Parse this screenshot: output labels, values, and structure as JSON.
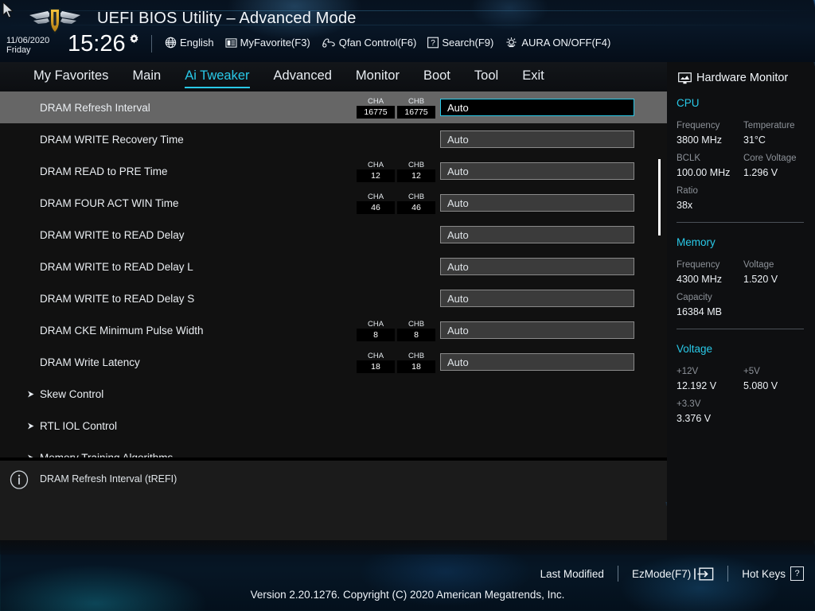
{
  "header": {
    "title": "UEFI BIOS Utility – Advanced Mode",
    "date": "11/06/2020",
    "weekday": "Friday",
    "time": "15:26",
    "gear_icon": "gear-icon",
    "items": [
      {
        "label": "English",
        "icon": "globe-icon"
      },
      {
        "label": "MyFavorite(F3)",
        "icon": "list-icon"
      },
      {
        "label": "Qfan Control(F6)",
        "icon": "fan-icon"
      },
      {
        "label": "Search(F9)",
        "icon": "question-box-icon"
      },
      {
        "label": "AURA ON/OFF(F4)",
        "icon": "aura-light-icon"
      }
    ]
  },
  "nav": {
    "tabs": [
      {
        "label": "My Favorites",
        "active": false
      },
      {
        "label": "Main",
        "active": false
      },
      {
        "label": "Ai Tweaker",
        "active": true
      },
      {
        "label": "Advanced",
        "active": false
      },
      {
        "label": "Monitor",
        "active": false
      },
      {
        "label": "Boot",
        "active": false
      },
      {
        "label": "Tool",
        "active": false
      },
      {
        "label": "Exit",
        "active": false
      }
    ],
    "active_color": "#29c9e8"
  },
  "settings": {
    "channel_labels": {
      "a": "CHA",
      "b": "CHB"
    },
    "rows": [
      {
        "label": "DRAM Refresh Interval",
        "cha": "16775",
        "chb": "16775",
        "value": "Auto",
        "selected": true,
        "submenu": false
      },
      {
        "label": "DRAM WRITE Recovery Time",
        "cha": null,
        "chb": null,
        "value": "Auto",
        "selected": false,
        "submenu": false
      },
      {
        "label": "DRAM READ to PRE Time",
        "cha": "12",
        "chb": "12",
        "value": "Auto",
        "selected": false,
        "submenu": false
      },
      {
        "label": "DRAM FOUR ACT WIN Time",
        "cha": "46",
        "chb": "46",
        "value": "Auto",
        "selected": false,
        "submenu": false
      },
      {
        "label": "DRAM WRITE to READ Delay",
        "cha": null,
        "chb": null,
        "value": "Auto",
        "selected": false,
        "submenu": false
      },
      {
        "label": "DRAM WRITE to READ Delay L",
        "cha": null,
        "chb": null,
        "value": "Auto",
        "selected": false,
        "submenu": false
      },
      {
        "label": "DRAM WRITE to READ Delay S",
        "cha": null,
        "chb": null,
        "value": "Auto",
        "selected": false,
        "submenu": false
      },
      {
        "label": "DRAM CKE Minimum Pulse Width",
        "cha": "8",
        "chb": "8",
        "value": "Auto",
        "selected": false,
        "submenu": false
      },
      {
        "label": "DRAM Write Latency",
        "cha": "18",
        "chb": "18",
        "value": "Auto",
        "selected": false,
        "submenu": false
      },
      {
        "label": "Skew Control",
        "cha": null,
        "chb": null,
        "value": null,
        "selected": false,
        "submenu": true
      },
      {
        "label": "RTL IOL Control",
        "cha": null,
        "chb": null,
        "value": null,
        "selected": false,
        "submenu": true
      },
      {
        "label": "Memory Training Algorithms",
        "cha": null,
        "chb": null,
        "value": null,
        "selected": false,
        "submenu": true
      }
    ]
  },
  "help": {
    "icon": "info-icon",
    "text": "DRAM Refresh Interval (tREFI)"
  },
  "hardware_monitor": {
    "title": "Hardware Monitor",
    "icon": "monitor-icon",
    "sections": [
      {
        "name": "CPU",
        "pairs": [
          [
            {
              "label": "Frequency",
              "value": "3800 MHz"
            },
            {
              "label": "Temperature",
              "value": "31°C"
            }
          ],
          [
            {
              "label": "BCLK",
              "value": "100.00 MHz"
            },
            {
              "label": "Core Voltage",
              "value": "1.296 V"
            }
          ],
          [
            {
              "label": "Ratio",
              "value": "38x"
            }
          ]
        ]
      },
      {
        "name": "Memory",
        "pairs": [
          [
            {
              "label": "Frequency",
              "value": "4300 MHz"
            },
            {
              "label": "Voltage",
              "value": "1.520 V"
            }
          ],
          [
            {
              "label": "Capacity",
              "value": "16384 MB"
            }
          ]
        ]
      },
      {
        "name": "Voltage",
        "pairs": [
          [
            {
              "label": "+12V",
              "value": "12.192 V"
            },
            {
              "label": "+5V",
              "value": "5.080 V"
            }
          ],
          [
            {
              "label": "+3.3V",
              "value": "3.376 V"
            }
          ]
        ]
      }
    ]
  },
  "footer": {
    "last_modified": "Last Modified",
    "ezmode": "EzMode(F7)",
    "hotkeys": "Hot Keys",
    "hotkeys_key": "?",
    "version": "Version 2.20.1276. Copyright (C) 2020 American Megatrends, Inc."
  }
}
